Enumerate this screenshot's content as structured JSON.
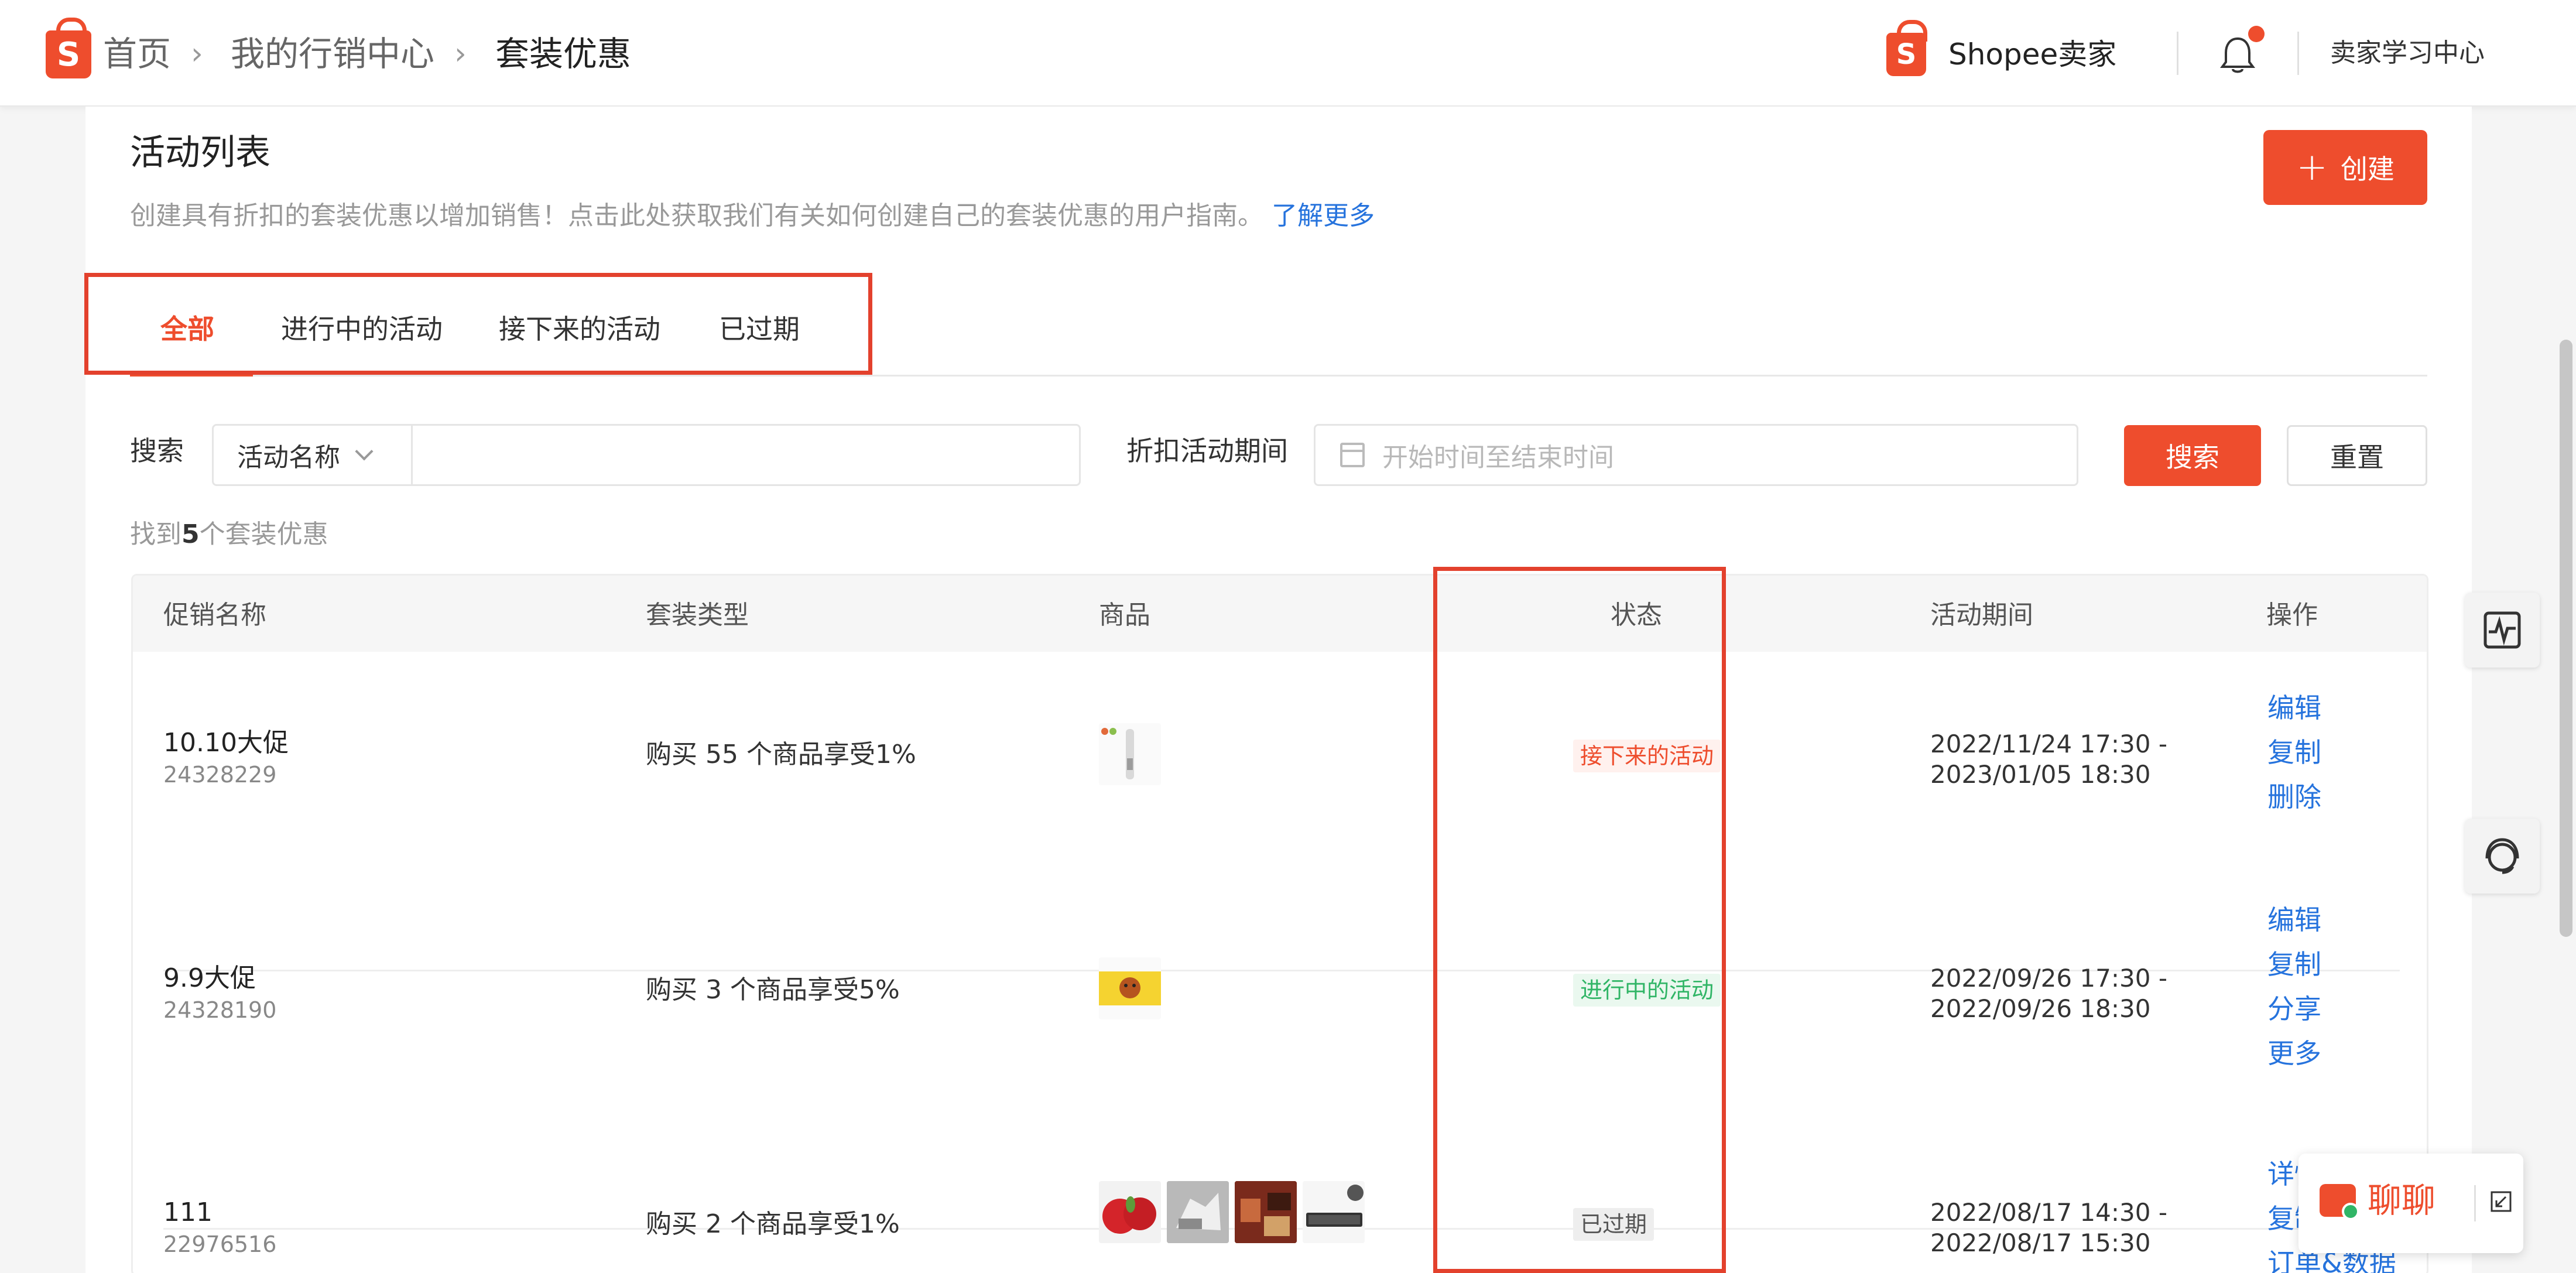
{
  "breadcrumb": [
    "首页",
    "我的行销中心",
    "套装优惠"
  ],
  "header": {
    "brand": "Shopee卖家",
    "learning_center": "卖家学习中心"
  },
  "page": {
    "title": "活动列表",
    "description": "创建具有折扣的套装优惠以增加销售！点击此处获取我们有关如何创建自己的套装优惠的用户指南。",
    "learn_more": "了解更多",
    "create_label": "创建"
  },
  "tabs": [
    {
      "label": "全部",
      "active": true
    },
    {
      "label": "进行中的活动",
      "active": false
    },
    {
      "label": "接下来的活动",
      "active": false
    },
    {
      "label": "已过期",
      "active": false
    }
  ],
  "search": {
    "label": "搜索",
    "type_selected": "活动名称",
    "input_value": "",
    "period_label": "折扣活动期间",
    "period_placeholder": "开始时间至结束时间",
    "search_button": "搜索",
    "reset_button": "重置"
  },
  "result": {
    "prefix": "找到",
    "count": "5",
    "suffix": "个套装优惠"
  },
  "table": {
    "columns": [
      "促销名称",
      "套装类型",
      "商品",
      "状态",
      "活动期间",
      "操作"
    ],
    "rows": [
      {
        "name": "10.10大促",
        "id": "24328229",
        "type": "购买 55 个商品享受1%",
        "status": "接下来的活动",
        "status_kind": "upcoming",
        "period_start": "2022/11/24 17:30 -",
        "period_end": "2023/01/05 18:30",
        "actions": [
          "编辑",
          "复制",
          "删除"
        ]
      },
      {
        "name": "9.9大促",
        "id": "24328190",
        "type": "购买 3 个商品享受5%",
        "status": "进行中的活动",
        "status_kind": "ongoing",
        "period_start": "2022/09/26 17:30 -",
        "period_end": "2022/09/26 18:30",
        "actions": [
          "编辑",
          "复制",
          "分享",
          "更多"
        ]
      },
      {
        "name": "111",
        "id": "22976516",
        "type": "购买 2 个商品享受1%",
        "status": "已过期",
        "status_kind": "expired",
        "period_start": "2022/08/17 14:30 -",
        "period_end": "2022/08/17 15:30",
        "actions": [
          "详情",
          "复制",
          "订单&数据"
        ]
      }
    ]
  },
  "chat": {
    "label": "聊聊"
  },
  "colors": {
    "brand": "#ee4d2d",
    "link": "#2673dd",
    "ongoing": "#30b566",
    "highlight_box": "#e3412d"
  }
}
